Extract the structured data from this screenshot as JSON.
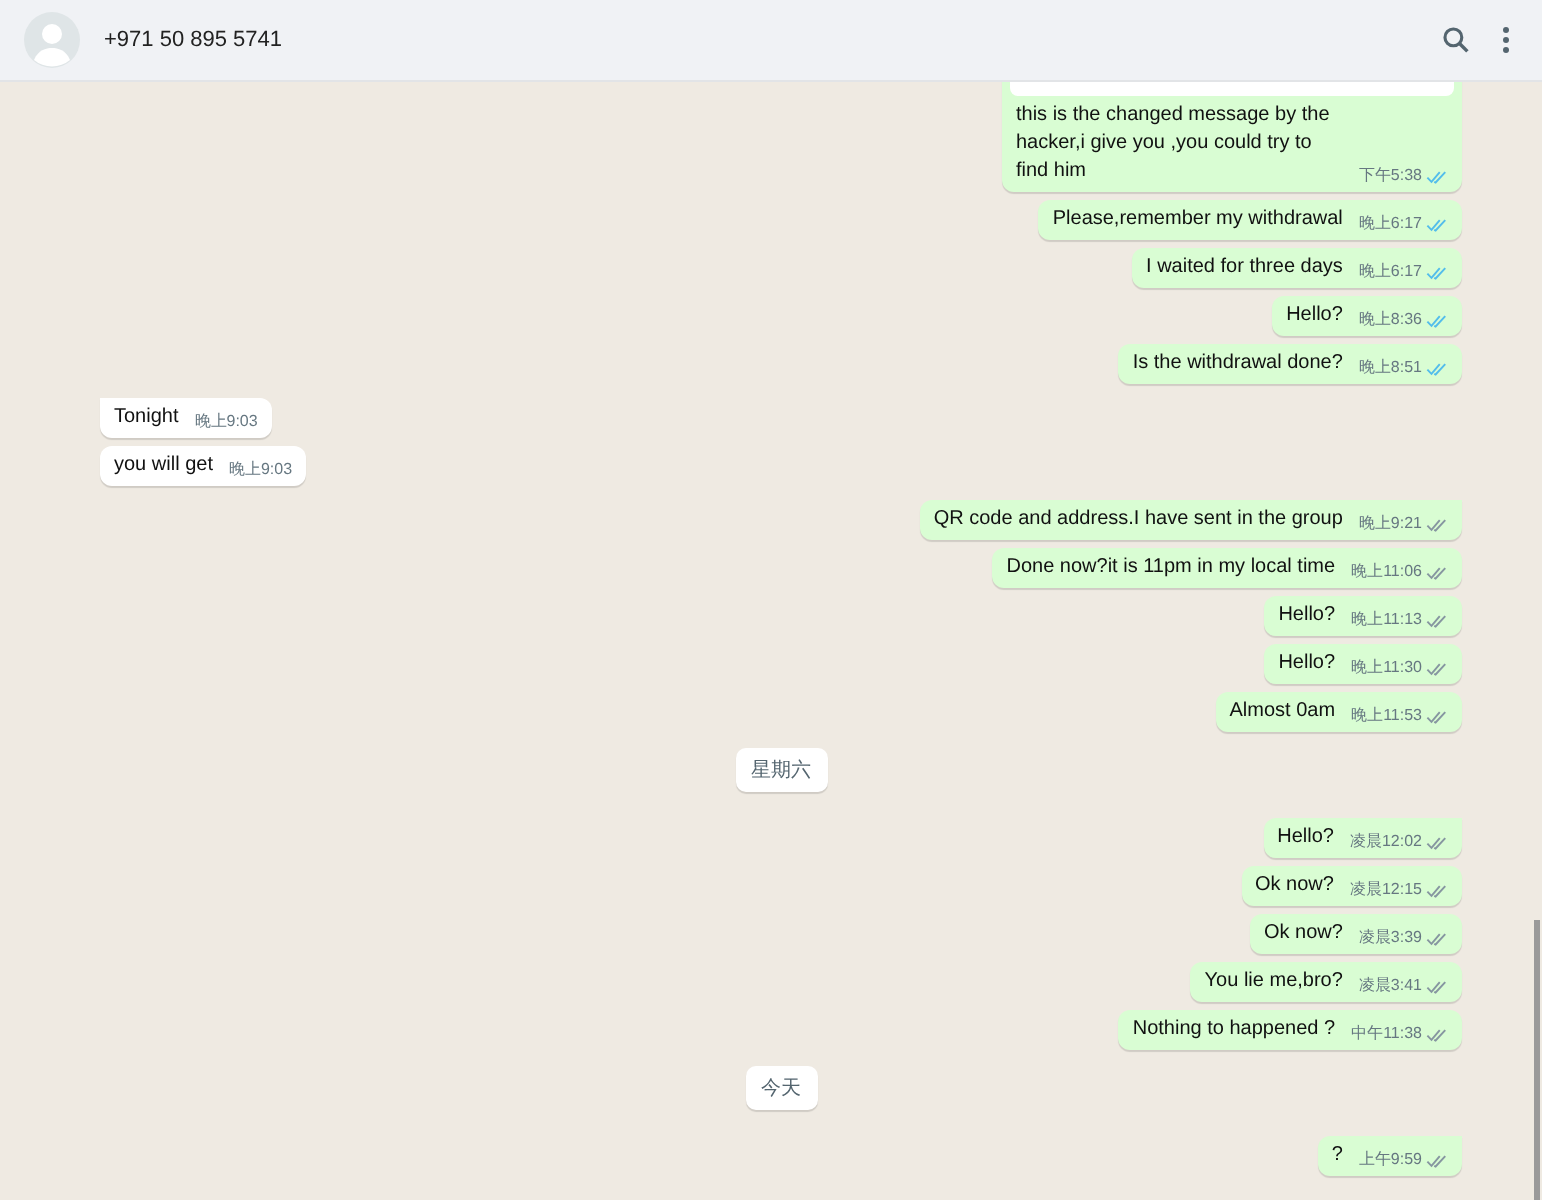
{
  "header": {
    "contact": "+971 50 895 5741"
  },
  "messages": [
    {
      "kind": "outgoing",
      "text": "this is the changed message by the hacker,i give you ,you could try to find him",
      "time": "下午5:38",
      "read": true,
      "tail": false,
      "quote": true
    },
    {
      "kind": "outgoing",
      "text": "Please,remember my withdrawal",
      "time": "晚上6:17",
      "read": true,
      "tail": false,
      "quote": false
    },
    {
      "kind": "outgoing",
      "text": "I waited for three days",
      "time": "晚上6:17",
      "read": true,
      "tail": false,
      "quote": false
    },
    {
      "kind": "outgoing",
      "text": "Hello?",
      "time": "晚上8:36",
      "read": true,
      "tail": false,
      "quote": false
    },
    {
      "kind": "outgoing",
      "text": "Is the withdrawal done?",
      "time": "晚上8:51",
      "read": true,
      "tail": false,
      "quote": false
    },
    {
      "kind": "incoming",
      "text": "Tonight",
      "time": "晚上9:03",
      "tail": true
    },
    {
      "kind": "incoming",
      "text": "you will get",
      "time": "晚上9:03",
      "tail": false
    },
    {
      "kind": "outgoing",
      "text": "QR code and address.I have sent in the group",
      "time": "晚上9:21",
      "read": false,
      "tail": true,
      "quote": false
    },
    {
      "kind": "outgoing",
      "text": "Done now?it is 11pm in my local time",
      "time": "晚上11:06",
      "read": false,
      "tail": false,
      "quote": false
    },
    {
      "kind": "outgoing",
      "text": "Hello?",
      "time": "晚上11:13",
      "read": false,
      "tail": false,
      "quote": false
    },
    {
      "kind": "outgoing",
      "text": "Hello?",
      "time": "晚上11:30",
      "read": false,
      "tail": false,
      "quote": false
    },
    {
      "kind": "outgoing",
      "text": "Almost 0am",
      "time": "晚上11:53",
      "read": false,
      "tail": false,
      "quote": false
    },
    {
      "kind": "date",
      "text": "星期六"
    },
    {
      "kind": "outgoing",
      "text": "Hello?",
      "time": "凌晨12:02",
      "read": false,
      "tail": true,
      "quote": false
    },
    {
      "kind": "outgoing",
      "text": "Ok now?",
      "time": "凌晨12:15",
      "read": false,
      "tail": false,
      "quote": false
    },
    {
      "kind": "outgoing",
      "text": "Ok now?",
      "time": "凌晨3:39",
      "read": false,
      "tail": false,
      "quote": false
    },
    {
      "kind": "outgoing",
      "text": "You lie me,bro?",
      "time": "凌晨3:41",
      "read": false,
      "tail": false,
      "quote": false
    },
    {
      "kind": "outgoing",
      "text": "Nothing to happened ?",
      "time": "中午11:38",
      "read": false,
      "tail": false,
      "quote": false
    },
    {
      "kind": "date",
      "text": "今天"
    },
    {
      "kind": "outgoing",
      "text": "?",
      "time": "上午9:59",
      "read": false,
      "tail": true,
      "quote": false
    }
  ]
}
